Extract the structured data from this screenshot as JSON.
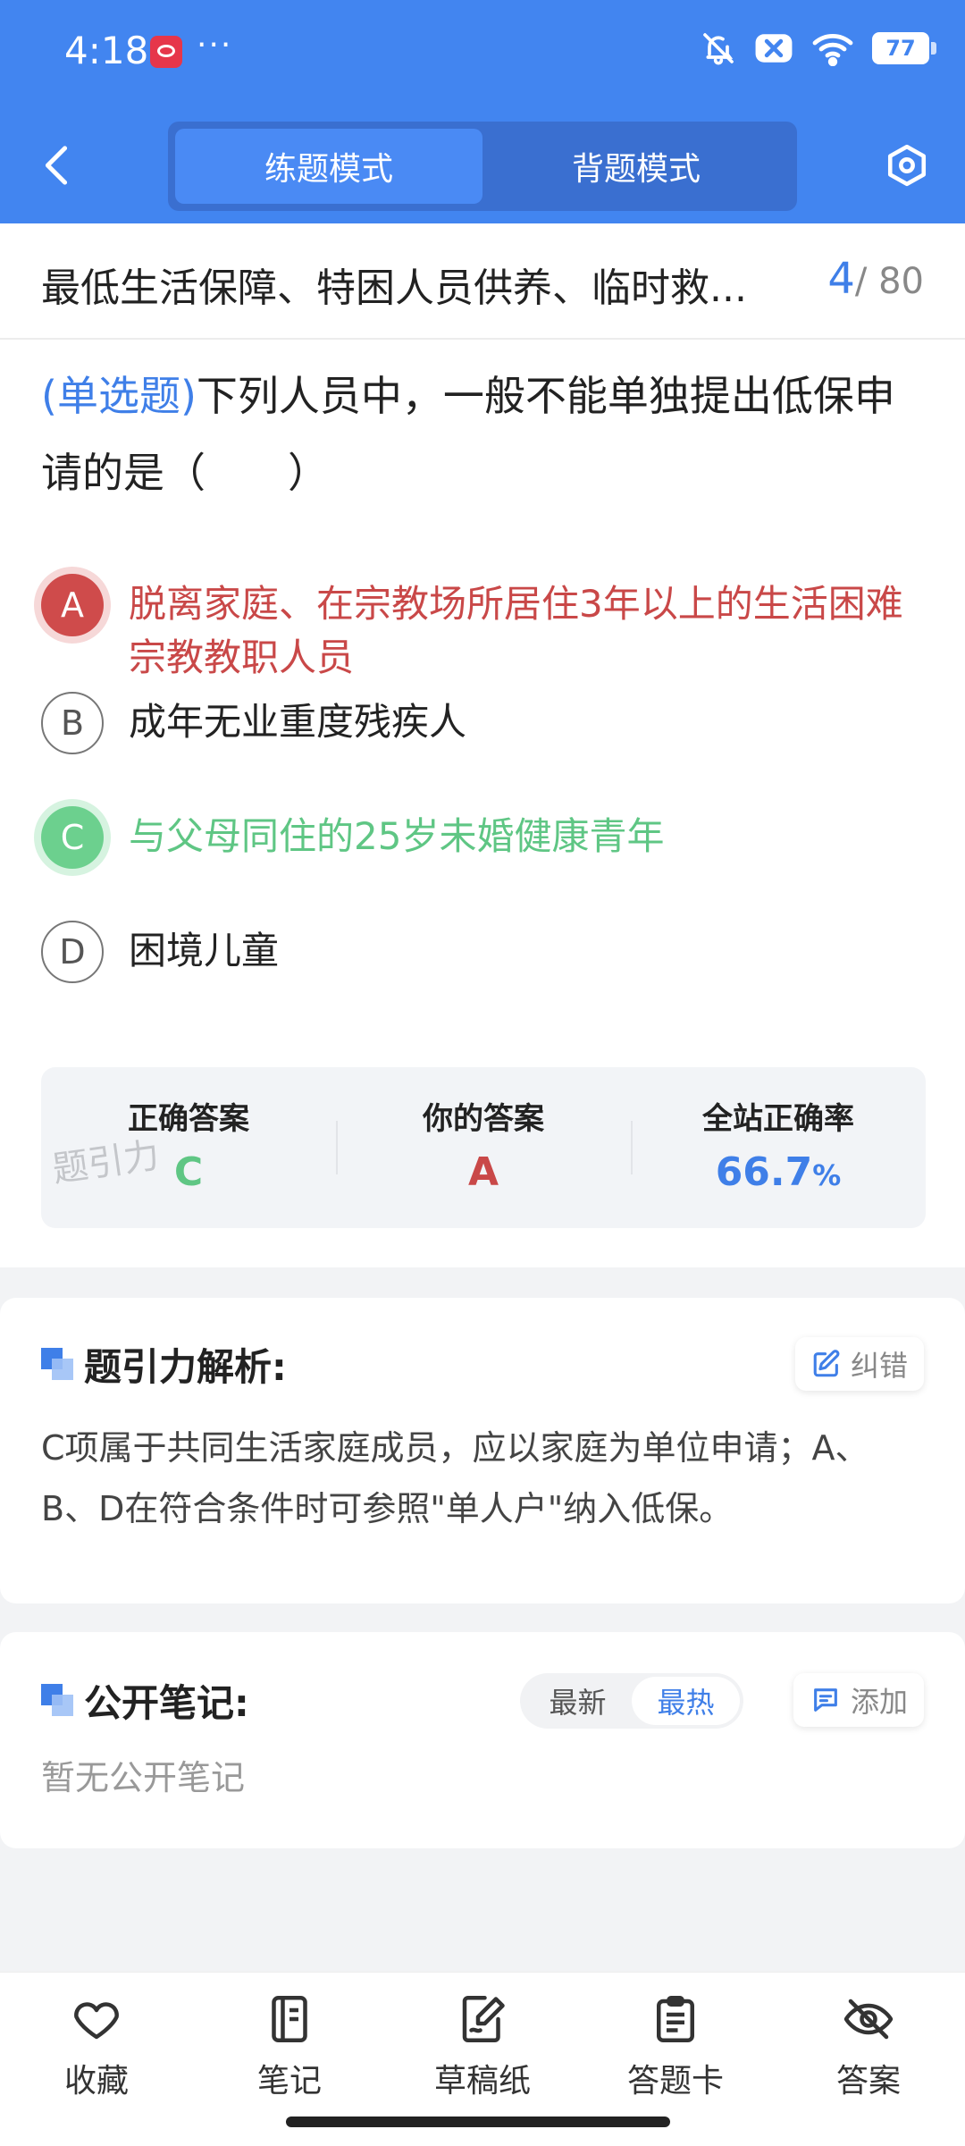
{
  "status_bar": {
    "time": "4:18",
    "more": "···",
    "battery": "77"
  },
  "header": {
    "modes": [
      "练题模式",
      "背题模式"
    ],
    "active_mode": 0
  },
  "chapter": {
    "title": "最低生活保障、特困人员供养、临时救...",
    "current": "4",
    "total": "/ 80"
  },
  "question": {
    "type": "(单选题)",
    "text": "下列人员中，一般不能单独提出低保申请的是（　　）",
    "options": [
      {
        "letter": "A",
        "text": "脱离家庭、在宗教场所居住3年以上的生活困难宗教教职人员",
        "state": "wrong"
      },
      {
        "letter": "B",
        "text": "成年无业重度残疾人",
        "state": "normal"
      },
      {
        "letter": "C",
        "text": "与父母同住的25岁未婚健康青年",
        "state": "right"
      },
      {
        "letter": "D",
        "text": "困境儿童",
        "state": "normal"
      }
    ]
  },
  "stats": {
    "correct_label": "正确答案",
    "correct_value": "C",
    "yours_label": "你的答案",
    "yours_value": "A",
    "rate_label": "全站正确率",
    "rate_value": "66.7",
    "rate_unit": "%",
    "watermark": "题引力"
  },
  "analysis": {
    "title": "题引力解析:",
    "correct_btn": "纠错",
    "text": "C项属于共同生活家庭成员，应以家庭为单位申请；A、B、D在符合条件时可参照\"单人户\"纳入低保。"
  },
  "notes": {
    "title": "公开笔记:",
    "sort": [
      "最新",
      "最热"
    ],
    "active_sort": 1,
    "add_btn": "添加",
    "empty": "暂无公开笔记"
  },
  "bottom_bar": {
    "items": [
      {
        "label": "收藏",
        "icon": "heart-icon"
      },
      {
        "label": "笔记",
        "icon": "notebook-icon"
      },
      {
        "label": "草稿纸",
        "icon": "draft-icon"
      },
      {
        "label": "答题卡",
        "icon": "answer-sheet-icon"
      },
      {
        "label": "答案",
        "icon": "eye-off-icon"
      }
    ]
  },
  "colors": {
    "brand": "#4285f0",
    "wrong": "#c94848",
    "right": "#5fc684"
  }
}
